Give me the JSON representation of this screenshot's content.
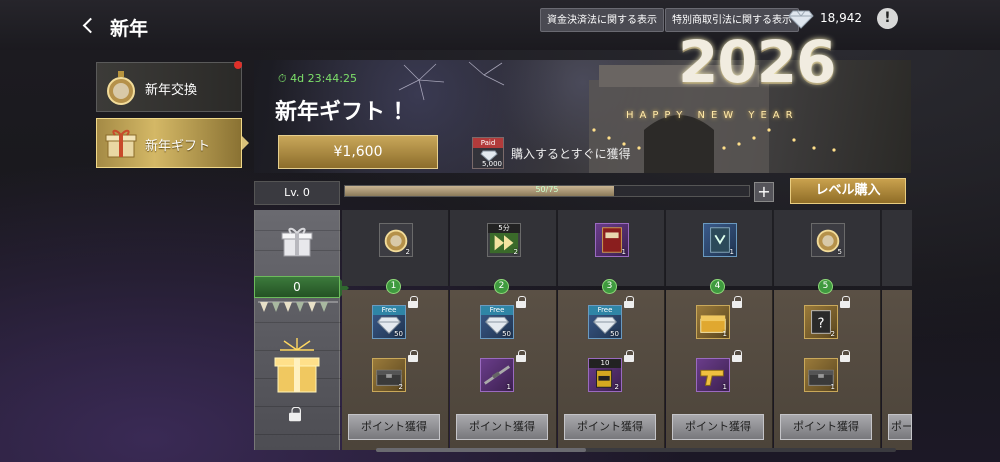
{
  "header": {
    "title": "新年",
    "btn_fund": "資金決済法に関する表示",
    "btn_commerce": "特別商取引法に関する表示",
    "gem_count": "18,942",
    "info": "!"
  },
  "sidebar": {
    "items": [
      {
        "label": "新年交換",
        "icon": "medal-icon",
        "badge": true
      },
      {
        "label": "新年ギフト",
        "icon": "gift-icon",
        "active": true
      }
    ]
  },
  "banner": {
    "timer": "4d 23:44:25",
    "title": "新年ギフト ！",
    "price": "¥1,600",
    "paid_tag": "Paid",
    "paid_qty": "5,000",
    "bonus_text": "購入するとすぐに獲得",
    "year": "2026",
    "happy": "HAPPY NEW YEAR"
  },
  "progress": {
    "level_label": "Lv. 0",
    "text": "50/75",
    "fraction": 0.667,
    "plus": "+",
    "buy_label": "レベル購入"
  },
  "rewards": {
    "start_level": "0",
    "columns": [
      {
        "level": "1",
        "free_item": {
          "icon": "medal-icon",
          "qty": "2"
        },
        "paid1": {
          "tag": "Free",
          "icon": "diamond-icon",
          "qty": "50"
        },
        "paid2": {
          "icon": "crate-icon",
          "qty": "2"
        },
        "btn": "ポイント獲得"
      },
      {
        "level": "2",
        "free_item": {
          "icon": "speedup-icon",
          "qty": "2",
          "tag": "5分"
        },
        "paid1": {
          "tag": "Free",
          "icon": "diamond-icon",
          "qty": "50"
        },
        "paid2": {
          "icon": "rifle-icon",
          "qty": "1"
        },
        "btn": "ポイント獲得"
      },
      {
        "level": "3",
        "free_item": {
          "icon": "red-book-icon",
          "qty": "1"
        },
        "paid1": {
          "tag": "Free",
          "icon": "diamond-icon",
          "qty": "50"
        },
        "paid2": {
          "icon": "ammo-icon",
          "qty": "2",
          "tag": "10"
        },
        "btn": "ポイント獲得"
      },
      {
        "level": "4",
        "free_item": {
          "icon": "blue-book-icon",
          "qty": "1"
        },
        "paid1": {
          "icon": "gold-chest-icon",
          "qty": "1"
        },
        "paid2": {
          "icon": "gold-pistol-icon",
          "qty": "1"
        },
        "btn": "ポイント獲得"
      },
      {
        "level": "5",
        "free_item": {
          "icon": "medal-icon",
          "qty": "5"
        },
        "paid1": {
          "icon": "mystery-box-icon",
          "qty": "2"
        },
        "paid2": {
          "icon": "crate-icon",
          "qty": "1"
        },
        "btn": "ポイント獲得"
      }
    ],
    "partial_btn": "ポー"
  },
  "colors": {
    "gold": "#c9a75a",
    "green": "#3f9a3f",
    "free_tag": "#2f85a6",
    "badge_red": "#e0302a"
  }
}
